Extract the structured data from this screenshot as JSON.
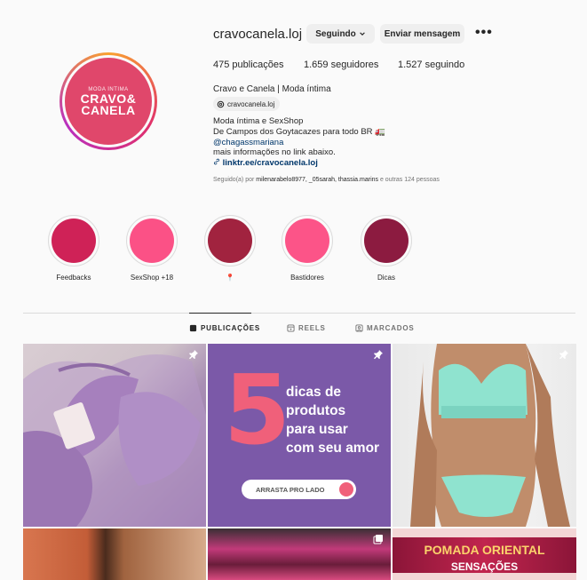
{
  "profile": {
    "username": "cravocanela.loj",
    "follow_button": "Seguindo",
    "message_button": "Enviar mensagem",
    "more_label": "•••",
    "avatar_small_text": "MODA ÍNTIMA",
    "avatar_brand_line1": "CRAVO&",
    "avatar_brand_line2": "CANELA",
    "stats": {
      "posts": "475 publicações",
      "followers": "1.659 seguidores",
      "following": "1.527 seguindo"
    },
    "full_name": "Cravo e Canela | Moda íntima",
    "threads_handle": "cravocanela.loj",
    "bio_line1": "Moda íntima e SexShop",
    "bio_line2": "De Campos dos Goytacazes para todo BR 🚛",
    "bio_mention": "@chagassmariana",
    "bio_line4": "mais informações no link abaixo.",
    "bio_link": "linktr.ee/cravocanela.loj",
    "followed_by_prefix": "Seguido(a) por ",
    "followed_by_names": "milenarabelo8977, _05sarah, thassia.marins",
    "followed_by_suffix": " e outras 124 pessoas"
  },
  "highlights": [
    {
      "label": "Feedbacks",
      "color": "#cf2257"
    },
    {
      "label": "SexShop +18",
      "color": "#fb5186"
    },
    {
      "label": "📍",
      "color": "#a1233f"
    },
    {
      "label": "Bastidores",
      "color": "#fc5488"
    },
    {
      "label": "Dicas",
      "color": "#8c1b40"
    }
  ],
  "tabs": {
    "posts": "PUBLICAÇÕES",
    "reels": "REELS",
    "tagged": "MARCADOS"
  },
  "posts": {
    "post2_number": "5",
    "post2_line1": "dicas de",
    "post2_line2": "produtos",
    "post2_line3": "para usar",
    "post2_line4": "com seu amor",
    "post2_swipe": "ARRASTA PRO LADO",
    "post6_line1": "POMADA ORIENTAL",
    "post6_line2": "SENSAÇÕES"
  }
}
